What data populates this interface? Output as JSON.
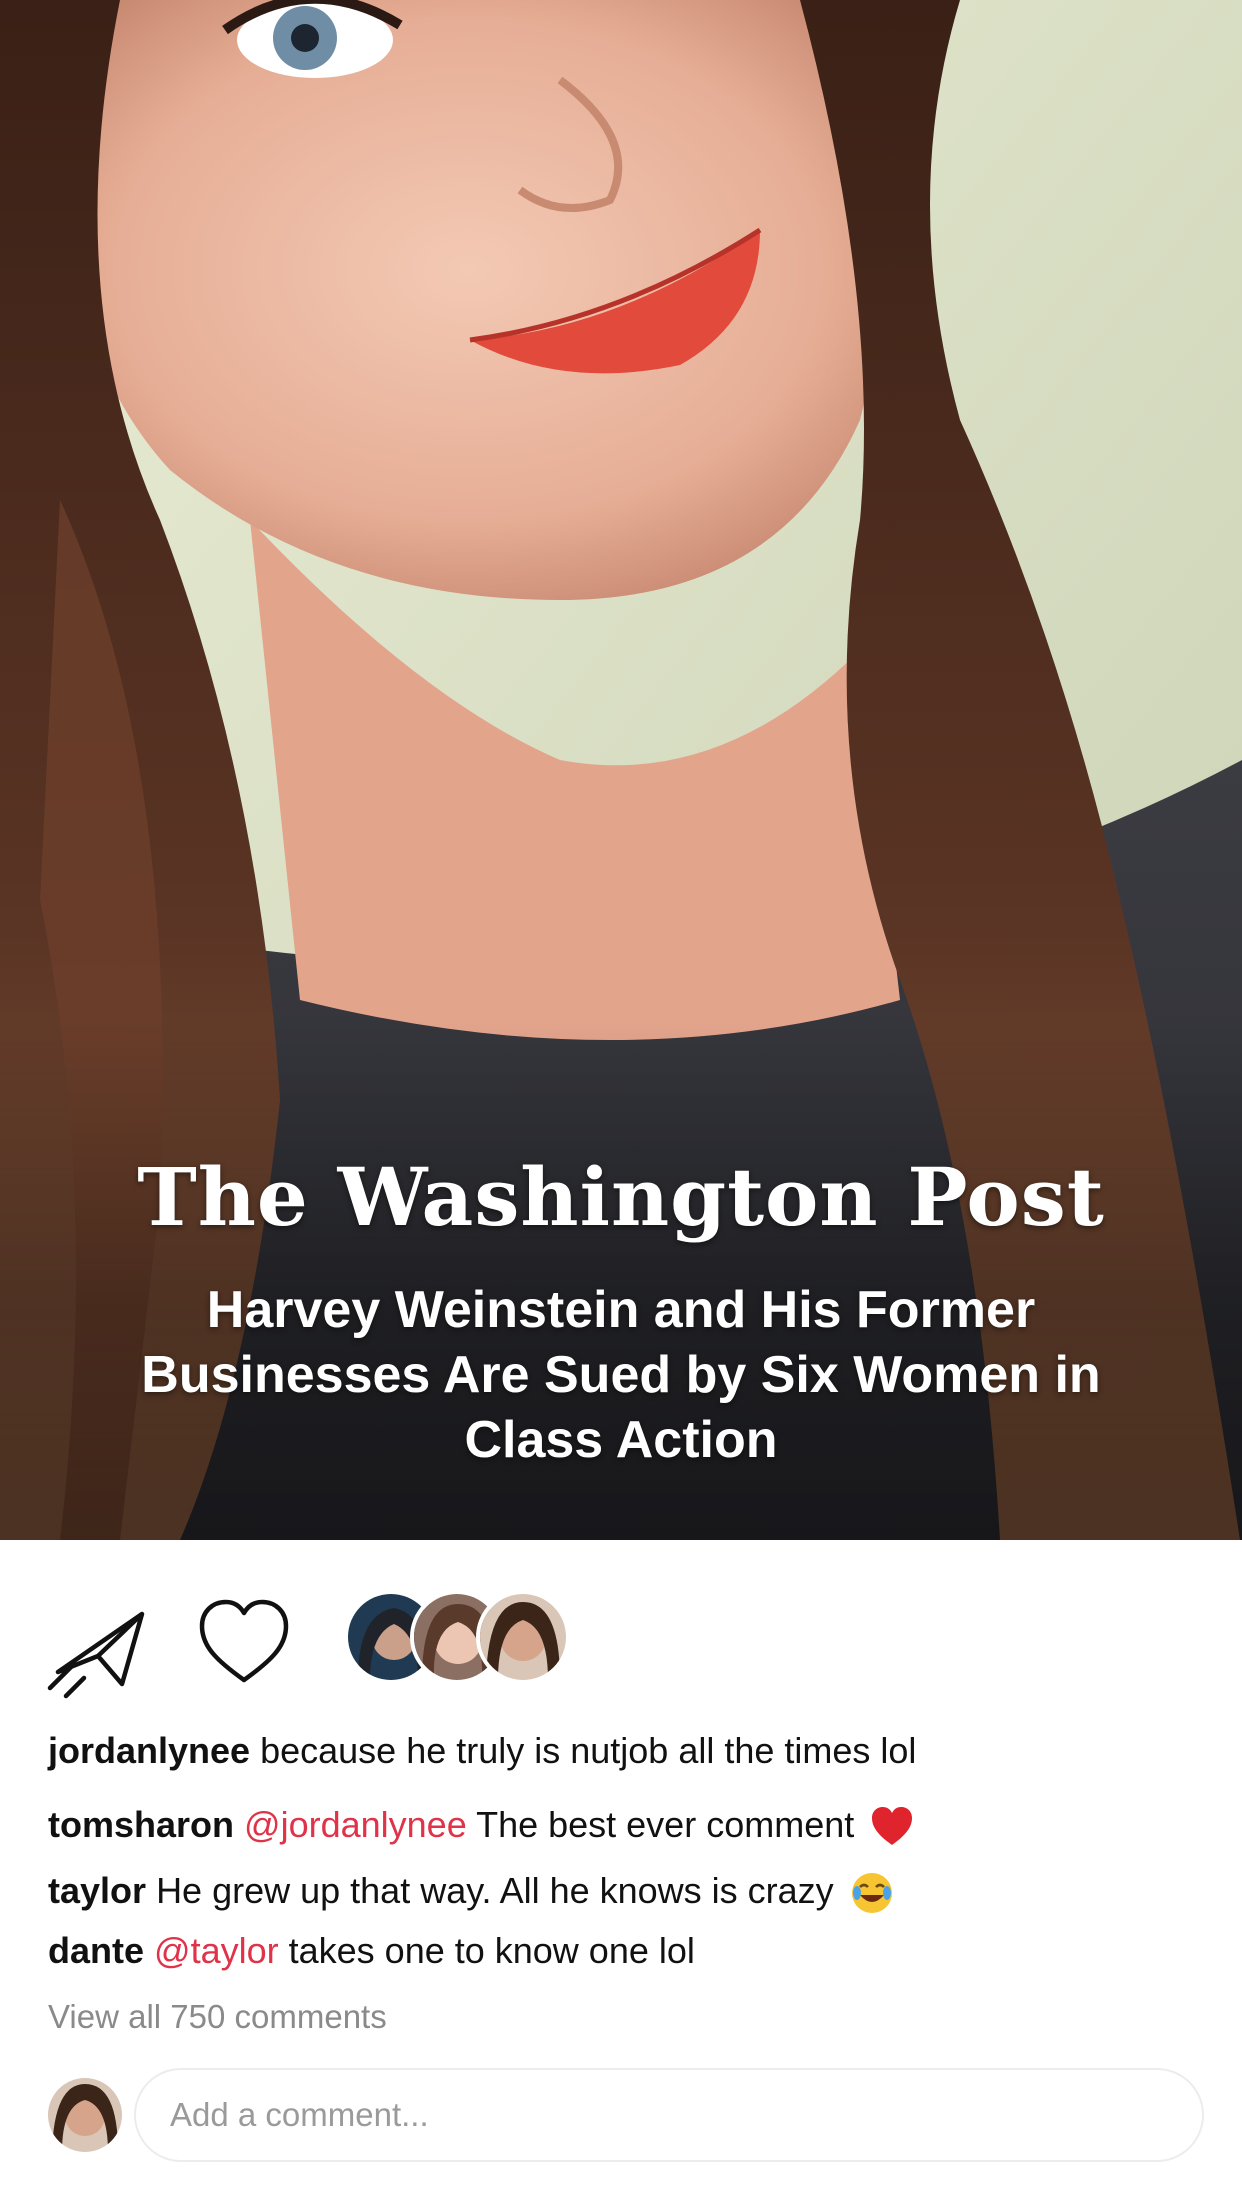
{
  "post": {
    "publication": "The Washington Post",
    "headline": "Harvey Weinstein and His Former Businesses Are Sued by Six Women in Class Action"
  },
  "actions": {
    "share_icon": "paper-plane-icon",
    "like_icon": "heart-icon",
    "liked_by_avatars": [
      "avatar-1",
      "avatar-2",
      "avatar-3"
    ]
  },
  "comments": [
    {
      "user": "jordanlynee",
      "mention": "",
      "text": "because he truly is nutjob all the times lol",
      "emoji": ""
    },
    {
      "user": "tomsharon",
      "mention": "@jordanlynee",
      "text": "The best ever comment",
      "emoji": "red-heart"
    },
    {
      "user": "taylor",
      "mention": "",
      "text": "He grew up that way. All he knows is crazy",
      "emoji": "tears-of-joy"
    },
    {
      "user": "dante",
      "mention": "@taylor",
      "text": "takes one to know one lol",
      "emoji": ""
    }
  ],
  "view_all_label": "View all 750 comments",
  "add_comment": {
    "placeholder": "Add a comment..."
  },
  "colors": {
    "mention": "#e0334a",
    "background": "#ffffff"
  }
}
